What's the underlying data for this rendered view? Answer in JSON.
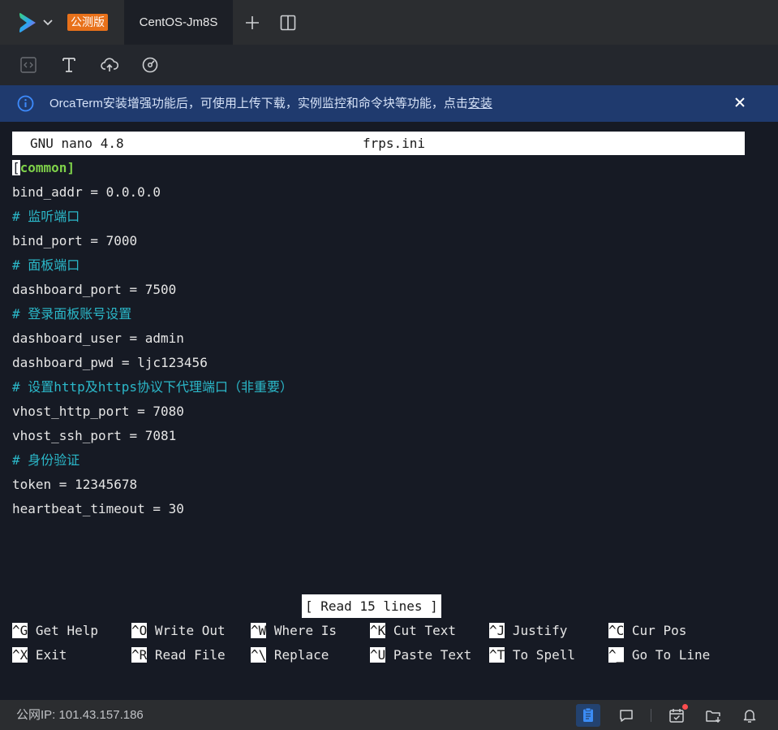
{
  "tabbar": {
    "badge": "公测版",
    "active_tab": "CentOS-Jm8S"
  },
  "notice": {
    "text": "OrcaTerm安装增强功能后，可使用上传下载，实例监控和命令块等功能，点击",
    "link": "安装"
  },
  "nano": {
    "version": "GNU nano 4.8",
    "filename": "frps.ini",
    "cursor_char": "[",
    "section_name": "common",
    "section_close": "]",
    "lines": [
      {
        "text": "bind_addr = 0.0.0.0",
        "type": "code"
      },
      {
        "text": "# 监听端口",
        "type": "comment"
      },
      {
        "text": "bind_port = 7000",
        "type": "code"
      },
      {
        "text": "# 面板端口",
        "type": "comment"
      },
      {
        "text": "dashboard_port = 7500",
        "type": "code"
      },
      {
        "text": "# 登录面板账号设置",
        "type": "comment"
      },
      {
        "text": "dashboard_user = admin",
        "type": "code"
      },
      {
        "text": "dashboard_pwd = ljc123456",
        "type": "code"
      },
      {
        "text": "# 设置http及https协议下代理端口（非重要）",
        "type": "comment"
      },
      {
        "text": "vhost_http_port = 7080",
        "type": "code"
      },
      {
        "text": "vhost_ssh_port = 7081",
        "type": "code"
      },
      {
        "text": "# 身份验证",
        "type": "comment"
      },
      {
        "text": "token = 12345678",
        "type": "code"
      },
      {
        "text": "heartbeat_timeout = 30",
        "type": "code"
      }
    ],
    "status": "[ Read 15 lines ]",
    "shortcuts_row1": [
      {
        "key": "^G",
        "label": "Get Help"
      },
      {
        "key": "^O",
        "label": "Write Out"
      },
      {
        "key": "^W",
        "label": "Where Is"
      },
      {
        "key": "^K",
        "label": "Cut Text"
      },
      {
        "key": "^J",
        "label": "Justify"
      },
      {
        "key": "^C",
        "label": "Cur Pos"
      }
    ],
    "shortcuts_row2": [
      {
        "key": "^X",
        "label": "Exit"
      },
      {
        "key": "^R",
        "label": "Read File"
      },
      {
        "key": "^\\",
        "label": "Replace"
      },
      {
        "key": "^U",
        "label": "Paste Text"
      },
      {
        "key": "^T",
        "label": "To Spell"
      },
      {
        "key": "^_",
        "label": "Go To Line"
      }
    ]
  },
  "statusbar": {
    "ip_label": "公网IP: 101.43.157.186",
    "icons": [
      "clipboard-icon",
      "chat-icon",
      "calendar-check-icon",
      "folder-download-icon",
      "bell-icon"
    ]
  },
  "colors": {
    "background": "#161a24",
    "accent_orange": "#e8711a",
    "notice_bg": "#1f3a6e",
    "comment": "#2bb8c9",
    "section": "#7fd24a"
  }
}
